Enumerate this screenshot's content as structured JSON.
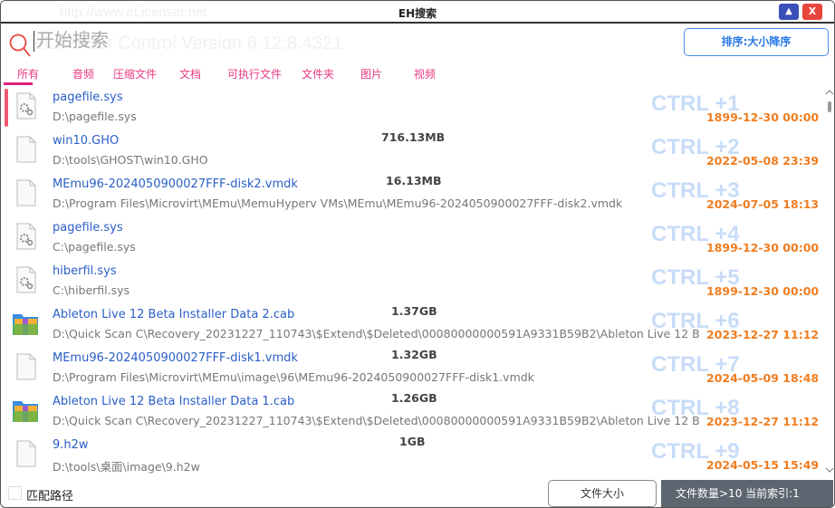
{
  "window": {
    "title": "EH搜索",
    "minimize_label": "▲",
    "close_label": "X",
    "watermark_url": "http://www.eLicenser.net",
    "watermark_version": "eLicenser Control Version 6.12.8.4321"
  },
  "search": {
    "placeholder": "开始搜索",
    "value": ""
  },
  "sort_button": "排序:大小降序",
  "tabs": [
    {
      "label": "所有",
      "active": true
    },
    {
      "label": "音频"
    },
    {
      "label": "压缩文件"
    },
    {
      "label": "文档"
    },
    {
      "label": "可执行文件"
    },
    {
      "label": "文件夹"
    },
    {
      "label": "图片"
    },
    {
      "label": "视频"
    }
  ],
  "results": [
    {
      "name": "pagefile.sys",
      "path": "D:\\pagefile.sys",
      "size": "",
      "shortcut": "CTRL +1",
      "date": "1899-12-30 00:00",
      "icon": "system-file-icon"
    },
    {
      "name": "win10.GHO",
      "path": "D:\\tools\\GHOST\\win10.GHO",
      "size": "716.13MB",
      "shortcut": "CTRL +2",
      "date": "2022-05-08 23:39",
      "icon": "file-icon"
    },
    {
      "name": "MEmu96-2024050900027FFF-disk2.vmdk",
      "path": "D:\\Program Files\\Microvirt\\MEmu\\MemuHyperv VMs\\MEmu\\MEmu96-2024050900027FFF-disk2.vmdk",
      "size": "16.13MB",
      "shortcut": "CTRL +3",
      "date": "2024-07-05 18:13",
      "icon": "file-icon"
    },
    {
      "name": "pagefile.sys",
      "path": "C:\\pagefile.sys",
      "size": "",
      "shortcut": "CTRL +4",
      "date": "1899-12-30 00:00",
      "icon": "system-file-icon"
    },
    {
      "name": "hiberfil.sys",
      "path": "C:\\hiberfil.sys",
      "size": "",
      "shortcut": "CTRL +5",
      "date": "1899-12-30 00:00",
      "icon": "system-file-icon"
    },
    {
      "name": "Ableton Live 12 Beta Installer Data 2.cab",
      "path": "D:\\Quick Scan C\\Recovery_20231227_110743\\$Extend\\$Deleted\\00080000000591A9331B59B2\\Ableton Live 12 Beta",
      "size": "1.37GB",
      "shortcut": "CTRL +6",
      "date": "2023-12-27 11:12",
      "icon": "archive-icon"
    },
    {
      "name": "MEmu96-2024050900027FFF-disk1.vmdk",
      "path": "D:\\Program Files\\Microvirt\\MEmu\\image\\96\\MEmu96-2024050900027FFF-disk1.vmdk",
      "size": "1.32GB",
      "shortcut": "CTRL +7",
      "date": "2024-05-09 18:48",
      "icon": "file-icon"
    },
    {
      "name": "Ableton Live 12 Beta Installer Data 1.cab",
      "path": "D:\\Quick Scan C\\Recovery_20231227_110743\\$Extend\\$Deleted\\00080000000591A9331B59B2\\Ableton Live 12 Beta",
      "size": "1.26GB",
      "shortcut": "CTRL +8",
      "date": "2023-12-27 11:12",
      "icon": "archive-icon"
    },
    {
      "name": "9.h2w",
      "path": "D:\\tools\\桌面\\image\\9.h2w",
      "size": "1GB",
      "shortcut": "CTRL +9",
      "date": "2024-05-15 15:49",
      "icon": "file-icon"
    }
  ],
  "footer": {
    "match_path_label": "匹配路径",
    "match_path_checked": false,
    "file_size_button": "文件大小",
    "status": "文件数量>10 当前索引:1"
  },
  "colors": {
    "accent": "#e0207a",
    "link": "#2a5fc8",
    "date": "#f07d20",
    "sort": "#2a7ae8"
  }
}
